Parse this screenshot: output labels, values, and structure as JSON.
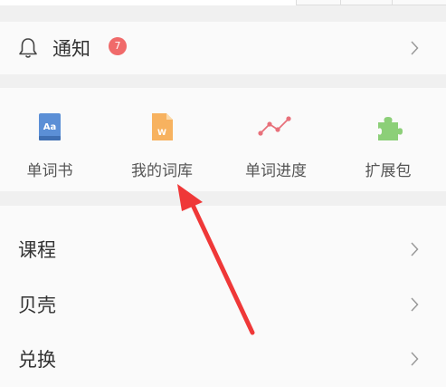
{
  "notifications": {
    "label": "通知",
    "badge": "7",
    "icon": "bell-icon"
  },
  "tools": [
    {
      "label": "单词书",
      "icon": "book-icon",
      "color": "#5b8fd6"
    },
    {
      "label": "我的词库",
      "icon": "word-file-icon",
      "color": "#f7b25f"
    },
    {
      "label": "单词进度",
      "icon": "line-chart-icon",
      "color": "#e8707a"
    },
    {
      "label": "扩展包",
      "icon": "puzzle-icon",
      "color": "#8ccf78"
    }
  ],
  "menu": [
    {
      "label": "课程"
    },
    {
      "label": "贝壳"
    },
    {
      "label": "兑换"
    }
  ],
  "colors": {
    "accent_red": "#ef3838",
    "badge": "#f06a6a",
    "background": "#f0f0f0",
    "card": "#fafafa"
  }
}
